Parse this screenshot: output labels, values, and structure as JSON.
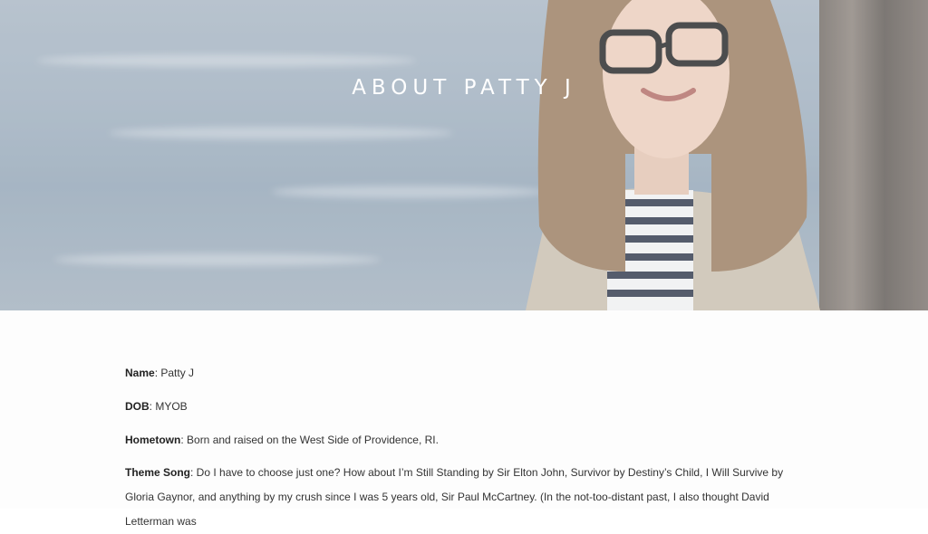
{
  "hero": {
    "title": "ABOUT PATTY J"
  },
  "facts": [
    {
      "label": "Name",
      "value": ": Patty J"
    },
    {
      "label": "DOB",
      "value": ": MYOB"
    },
    {
      "label": "Hometown",
      "value": ": Born and raised on the West Side of Providence, RI."
    },
    {
      "label": "Theme Song",
      "value": ": Do I have to choose just one?  How about I’m Still Standing by Sir Elton John, Survivor by Destiny’s Child, I Will Survive by Gloria Gaynor, and anything by my crush since I was 5 years old, Sir Paul McCartney. (In the not-too-distant past, I also thought David Letterman was"
    }
  ]
}
